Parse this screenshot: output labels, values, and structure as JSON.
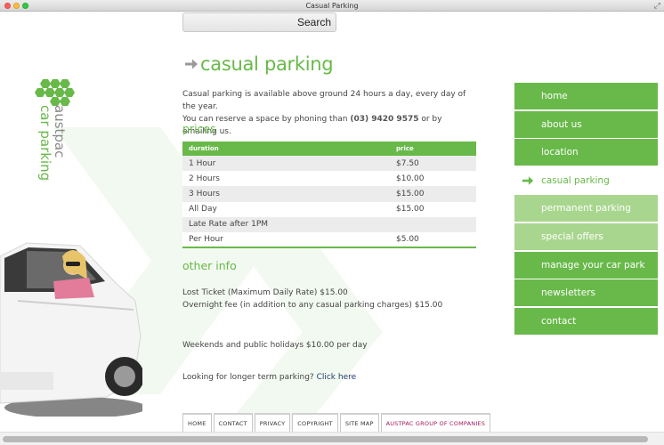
{
  "window": {
    "title": "Casual Parking"
  },
  "search": {
    "placeholder": "",
    "button_label": "Search"
  },
  "logo": {
    "line1": "austpac",
    "line2": "car parking"
  },
  "page": {
    "title": "casual parking",
    "intro_line1": "Casual parking is available above ground 24 hours a day, every day of the year.",
    "intro_line2_pre": "You can reserve a space by phoning than ",
    "intro_phone": "(03) 9420 9575",
    "intro_line2_post": " or by emailing us."
  },
  "prices": {
    "heading": "prices",
    "columns": [
      "duration",
      "price"
    ],
    "rows": [
      {
        "duration": "1 Hour",
        "price": "$7.50"
      },
      {
        "duration": "2 Hours",
        "price": "$10.00"
      },
      {
        "duration": "3 Hours",
        "price": "$15.00"
      },
      {
        "duration": "All Day",
        "price": "$15.00"
      },
      {
        "duration": "Late Rate after 1PM",
        "price": ""
      },
      {
        "duration": "Per Hour",
        "price": "$5.00"
      }
    ]
  },
  "other_info": {
    "heading": "other info",
    "lost_ticket": "Lost Ticket (Maximum Daily Rate) $15.00",
    "overnight": "Overnight fee (in addition to any casual parking charges) $15.00",
    "weekends": "Weekends and public holidays $10.00 per day",
    "longer_term_pre": "Looking for longer term parking? ",
    "longer_term_link": "Click here"
  },
  "nav": {
    "items": [
      {
        "label": "home",
        "style": "green"
      },
      {
        "label": "about us",
        "style": "green"
      },
      {
        "label": "location",
        "style": "green"
      },
      {
        "label": "casual parking",
        "style": "active"
      },
      {
        "label": "permanent parking",
        "style": "light"
      },
      {
        "label": "special offers",
        "style": "light"
      },
      {
        "label": "manage your car park",
        "style": "green"
      },
      {
        "label": "newsletters",
        "style": "green"
      },
      {
        "label": "contact",
        "style": "green"
      }
    ]
  },
  "footer": {
    "items": [
      "HOME",
      "CONTACT",
      "PRIVACY",
      "COPYRIGHT",
      "SITE MAP",
      "AUSTPAC GROUP OF COMPANIES"
    ]
  },
  "colors": {
    "brand_green": "#68b949",
    "light_green": "#a9d68e",
    "link_blue": "#1f3c6e",
    "brand_magenta": "#a3185c"
  }
}
